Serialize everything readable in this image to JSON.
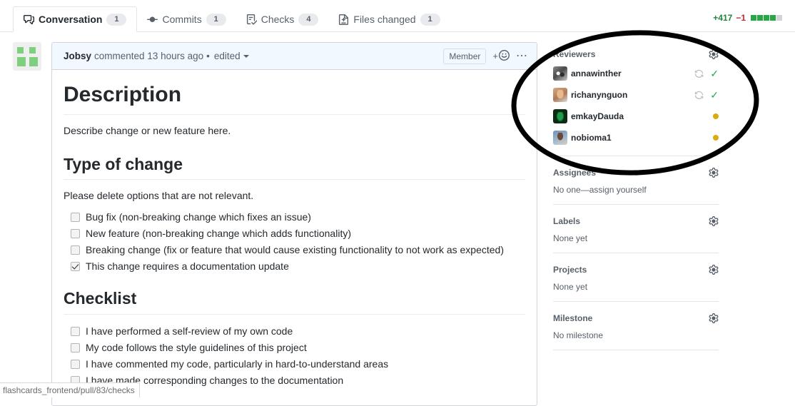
{
  "tabs": [
    {
      "label": "Conversation",
      "count": "1",
      "icon": "comment-discussion-icon",
      "selected": true
    },
    {
      "label": "Commits",
      "count": "1",
      "icon": "git-commit-icon",
      "selected": false
    },
    {
      "label": "Checks",
      "count": "4",
      "icon": "checklist-icon",
      "selected": false
    },
    {
      "label": "Files changed",
      "count": "1",
      "icon": "file-diff-icon",
      "selected": false
    }
  ],
  "diffstat": {
    "additions": "+417",
    "deletions": "−1",
    "blocks": [
      "on",
      "on",
      "on",
      "on",
      "off"
    ],
    "add_color": "#22863a",
    "del_color": "#cb2431",
    "block_on_color": "#28a745",
    "block_off_color": "#d1d5da"
  },
  "comment": {
    "author": "Jobsy",
    "action": "commented 13 hours ago",
    "separator": "•",
    "edited_label": "edited",
    "member_badge": "Member",
    "add_reaction_label": "+",
    "reaction_icon": "smiley-icon",
    "menu_icon": "kebab-horizontal-icon",
    "avatar_icon": "jobsy-avatar"
  },
  "body": {
    "description_heading": "Description",
    "description_text": "Describe change or new feature here.",
    "type_of_change_heading": "Type of change",
    "type_of_change_text": "Please delete options that are not relevant.",
    "type_of_change_items": [
      {
        "label": "Bug fix (non-breaking change which fixes an issue)",
        "checked": false
      },
      {
        "label": "New feature (non-breaking change which adds functionality)",
        "checked": false
      },
      {
        "label": "Breaking change (fix or feature that would cause existing functionality to not work as expected)",
        "checked": false
      },
      {
        "label": "This change requires a documentation update",
        "checked": true
      }
    ],
    "checklist_heading": "Checklist",
    "checklist_items": [
      {
        "label": "I have performed a self-review of my own code",
        "checked": false
      },
      {
        "label": "My code follows the style guidelines of this project",
        "checked": false
      },
      {
        "label": "I have commented my code, particularly in hard-to-understand areas",
        "checked": false
      },
      {
        "label": "I have made corresponding changes to the documentation",
        "checked": false
      }
    ]
  },
  "sidebar": {
    "reviewers": {
      "title": "Reviewers",
      "gear_icon": "gear-icon",
      "items": [
        {
          "name": "annawinther",
          "status": "approved",
          "status_icon": "check-icon",
          "rerequest_icon": "sync-icon",
          "has_rerequest": true,
          "avatar": "av-anna"
        },
        {
          "name": "richanynguon",
          "status": "approved",
          "status_icon": "check-icon",
          "rerequest_icon": "sync-icon",
          "has_rerequest": true,
          "avatar": "av-richa"
        },
        {
          "name": "emkayDauda",
          "status": "pending",
          "status_icon": "dot-icon",
          "has_rerequest": false,
          "avatar": "av-emkay"
        },
        {
          "name": "nobioma1",
          "status": "pending",
          "status_icon": "dot-icon",
          "has_rerequest": false,
          "avatar": "av-nobi"
        }
      ],
      "approved_color": "#28a745",
      "pending_color": "#dbab09"
    },
    "assignees": {
      "title": "Assignees",
      "value": "No one—assign yourself",
      "gear_icon": "gear-icon"
    },
    "labels": {
      "title": "Labels",
      "value": "None yet",
      "gear_icon": "gear-icon"
    },
    "projects": {
      "title": "Projects",
      "value": "None yet",
      "gear_icon": "gear-icon"
    },
    "milestone": {
      "title": "Milestone",
      "value": "No milestone",
      "gear_icon": "gear-icon"
    }
  },
  "status_bar": {
    "url": "flashcards_frontend/pull/83/checks"
  },
  "annotation": {
    "shape": "ellipse",
    "color": "#000000",
    "target": "reviewers-section"
  }
}
